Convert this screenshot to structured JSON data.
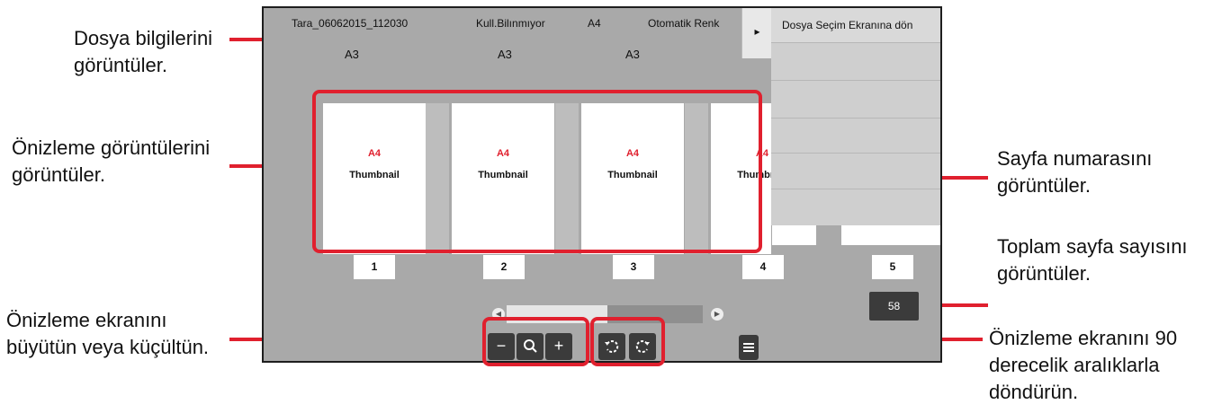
{
  "callouts": {
    "file_info": [
      "Dosya bilgilerini",
      "görüntüler."
    ],
    "preview_images": [
      "Önizleme görüntülerini",
      "görüntüler."
    ],
    "zoom": [
      "Önizleme ekranını",
      "büyütün veya küçültün."
    ],
    "page_number": [
      "Sayfa numarasını",
      "görüntüler."
    ],
    "total_pages": [
      "Toplam sayfa sayısını",
      "görüntüler."
    ],
    "rotate": [
      "Önizleme ekranını 90",
      "derecelik aralıklarla",
      "döndürün."
    ]
  },
  "screen": {
    "file_name": "Tara_06062015_112030",
    "user": "Kull.Bilınmıyor",
    "paper_size": "A4",
    "color_mode": "Otomatik Renk",
    "back_button": "Dosya Seçim Ekranına dön",
    "paper_labels": [
      "A3",
      "A3",
      "A3"
    ],
    "thumbnails": [
      {
        "size": "A4",
        "label": "Thumbnail"
      },
      {
        "size": "A4",
        "label": "Thumbnail"
      },
      {
        "size": "A4",
        "label": "Thumbnail"
      },
      {
        "size": "A4",
        "label": "Thumbnail"
      }
    ],
    "page_numbers": [
      "1",
      "2",
      "3",
      "4",
      "5"
    ],
    "total_pages": "58",
    "scroll_position": 0.5
  },
  "colors": {
    "highlight": "#e0202e",
    "screen_bg": "#a9a9a9",
    "button_dark": "#3b3b3b"
  },
  "icons": [
    "collapse-panel-icon",
    "minus-icon",
    "magnifier-icon",
    "plus-icon",
    "rotate-left-icon",
    "rotate-right-icon",
    "menu-icon",
    "scroll-left-icon",
    "scroll-right-icon"
  ]
}
